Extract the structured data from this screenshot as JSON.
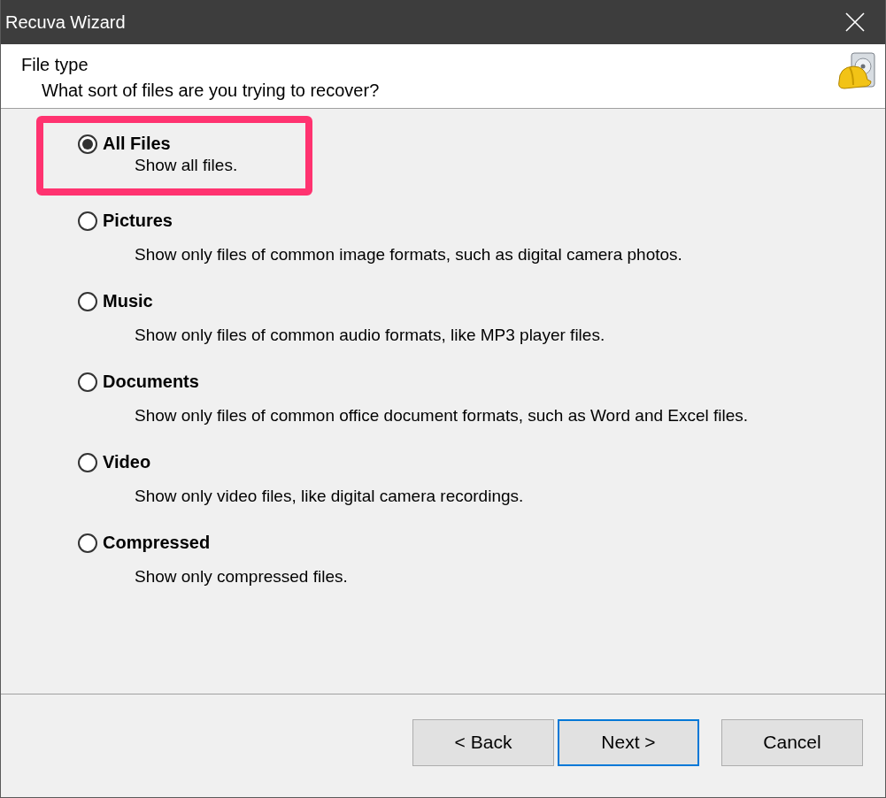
{
  "window": {
    "title": "Recuva Wizard"
  },
  "header": {
    "title": "File type",
    "subtitle": "What sort of files are you trying to recover?"
  },
  "options": [
    {
      "kind": "compact",
      "label": "All Files",
      "description": "Show all files.",
      "selected": true,
      "highlighted": true
    },
    {
      "kind": "standard",
      "label": "Pictures",
      "description": "Show only files of common image formats, such as digital camera photos.",
      "selected": false,
      "highlighted": false
    },
    {
      "kind": "standard",
      "label": "Music",
      "description": "Show only files of common audio formats, like MP3 player files.",
      "selected": false,
      "highlighted": false
    },
    {
      "kind": "standard",
      "label": "Documents",
      "description": "Show only files of common office document formats, such as Word and Excel files.",
      "selected": false,
      "highlighted": false
    },
    {
      "kind": "standard",
      "label": "Video",
      "description": "Show only video files, like digital camera recordings.",
      "selected": false,
      "highlighted": false
    },
    {
      "kind": "standard",
      "label": "Compressed",
      "description": "Show only compressed files.",
      "selected": false,
      "highlighted": false
    }
  ],
  "buttons": [
    {
      "label": "< Back",
      "default": false
    },
    {
      "label": "Next >",
      "default": true
    },
    {
      "label": "Cancel",
      "default": false
    }
  ]
}
